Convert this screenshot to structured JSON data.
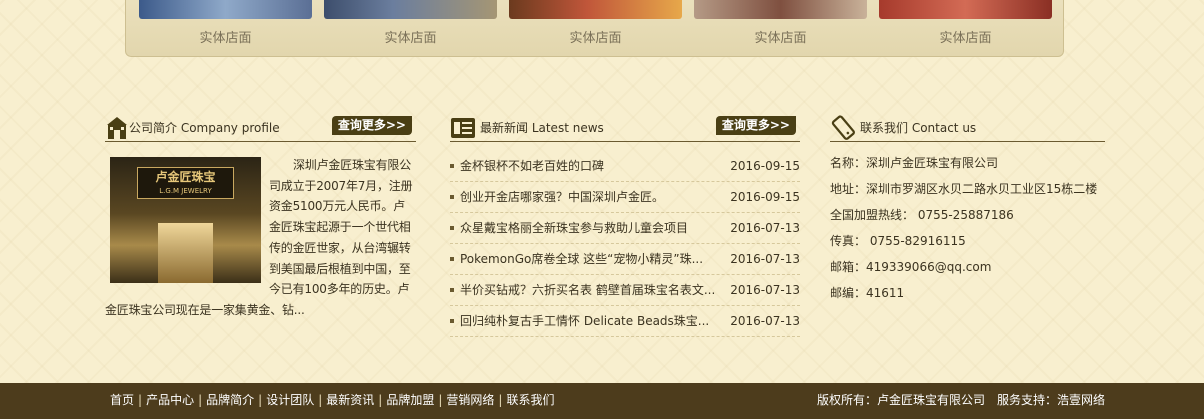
{
  "stores": [
    {
      "label": "实体店面"
    },
    {
      "label": "实体店面"
    },
    {
      "label": "实体店面"
    },
    {
      "label": "实体店面"
    },
    {
      "label": "实体店面"
    }
  ],
  "company": {
    "title": "公司简介 Company profile",
    "more": "查询更多>>",
    "icon": "store-icon",
    "image_sign": "卢金匠珠宝",
    "image_sign_en": "L.G.M JEWELRY",
    "text": "深圳卢金匠珠宝有限公司成立于2007年7月，注册资金5100万元人民币。卢金匠珠宝起源于一个世代相传的金匠世家，从台湾辗转到美国最后根植到中国，至今已有100多年的历史。卢金匠珠宝公司现在是一家集黄金、钻..."
  },
  "news": {
    "title": "最新新闻 Latest news",
    "more": "查询更多>>",
    "icon": "news-icon",
    "items": [
      {
        "title": "金杯银杯不如老百姓的口碑",
        "date": "2016-09-15"
      },
      {
        "title": "创业开金店哪家强？中国深圳卢金匠。",
        "date": "2016-09-15"
      },
      {
        "title": "众星戴宝格丽全新珠宝参与救助儿童会项目",
        "date": "2016-07-13"
      },
      {
        "title": "PokemonGo席卷全球 这些“宠物小精灵”珠...",
        "date": "2016-07-13"
      },
      {
        "title": "半价买钻戒？六折买名表 鹤壁首届珠宝名表文...",
        "date": "2016-07-13"
      },
      {
        "title": "回归纯朴复古手工情怀 Delicate Beads珠宝...",
        "date": "2016-07-13"
      }
    ]
  },
  "contact": {
    "title": "联系我们 Contact us",
    "icon": "phone-icon",
    "rows": [
      {
        "text": "名称：深圳卢金匠珠宝有限公司"
      },
      {
        "text": "地址：深圳市罗湖区水贝二路水贝工业区15栋二楼"
      },
      {
        "text": "全国加盟热线：  0755-25887186"
      },
      {
        "text": "传真：  0755-82916115"
      },
      {
        "text": "邮箱：419339066@qq.com"
      },
      {
        "text": "邮编：41611"
      }
    ]
  },
  "footer": {
    "nav": [
      "首页",
      "产品中心",
      "品牌简介",
      "设计团队",
      "最新资讯",
      "品牌加盟",
      "营销网络",
      "联系我们"
    ],
    "separator": "|",
    "copyright": "版权所有：卢金匠珠宝有限公司",
    "support": "服务支持：浩壹网络"
  },
  "colors": {
    "background": "#f8efcf",
    "accent": "#4a3f14",
    "footer": "#4d3c1c"
  }
}
